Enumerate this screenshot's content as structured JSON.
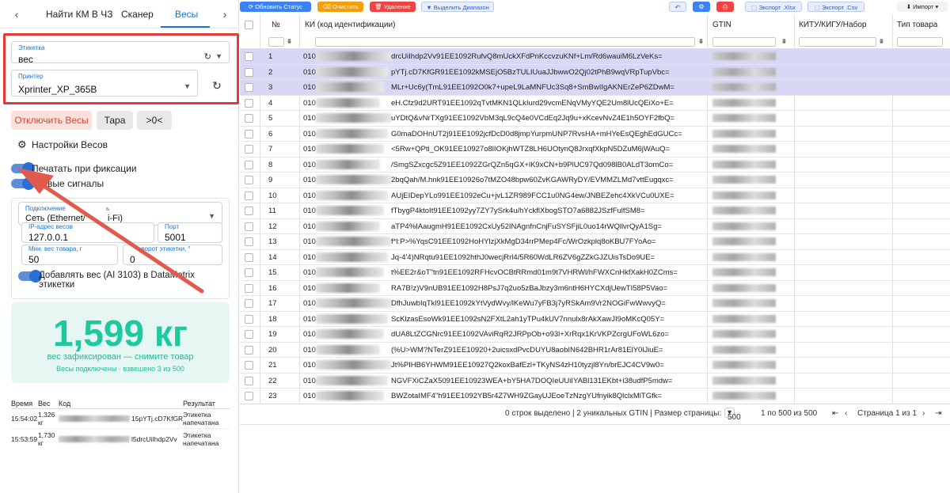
{
  "left": {
    "tabs": [
      "Найти КМ В ЧЗ",
      "Сканер",
      "Весы"
    ],
    "label_field": {
      "label": "Этикетка",
      "value": "вес"
    },
    "printer_field": {
      "label": "Принтер",
      "value": "Xprinter_XP_365B"
    },
    "buttons": {
      "disable_scales": "Отключить Весы",
      "tare": "Тара",
      "zero": ">0<"
    },
    "settings_title": "Настройки Весов",
    "toggles": {
      "print_on_fix": "Печатать при фиксации",
      "sound": "ковые сигналы"
    },
    "connection": {
      "label": "Подключение",
      "label_suffix": "ь",
      "value": "Сеть (Ethernet/",
      "value_suffix": "i-Fi)",
      "ip_label": "IP-адрес весов",
      "ip_value": "127.0.0.1",
      "port_label": "Порт",
      "port_value": "5001",
      "min_label": "Мин. вес товара, г",
      "min_value": "50",
      "rotate_label": "оворот этикетки, °",
      "rotate_value": "0",
      "add_weight": "Добавлять вес (AI 3103) в DataMatrix этикетки"
    },
    "weight": {
      "value": "1,599 кг",
      "status": "вес зафиксирован — снимите товар",
      "sub": "Весы подключены · взвешено 3 из 500"
    },
    "log": {
      "headers": [
        "Время",
        "Вес",
        "Код",
        "Результат"
      ],
      "rows": [
        {
          "time": "15:54:02",
          "weight": "1,326",
          "unit": "кг",
          "code_tail": "15pYTj.cD7KfGR",
          "result1": "Этикетка",
          "result2": "напечатана"
        },
        {
          "time": "15:53:59",
          "weight": "1,730",
          "unit": "кг",
          "code_tail": "l5drcUiIhdp2Vv",
          "result1": "Этикетка",
          "result2": "напечатана"
        }
      ]
    }
  },
  "toolbar": {
    "update_status": "Обновить Статус",
    "clear": "Очистить",
    "delete": "Удаление",
    "select_range": "Выделить Диапазон",
    "export_xlsx": "Экспорт .Xlsx",
    "export_csv": "Экспорт .Csv",
    "import": "Импорт"
  },
  "grid": {
    "headers": {
      "num": "№",
      "ki": "КИ (код идентификации)",
      "gtin": "GTIN",
      "kitu": "КИТУ/КИГУ/Набор",
      "type": "Тип товара"
    },
    "prefix": "010",
    "rows": [
      {
        "n": "1",
        "ki": "drcUiIhdp2Vv91EE1092RufvQ8mUckXFdPnKccvzuKNf+Lm/Rd6wauiM6LzVeKs=",
        "sel": true
      },
      {
        "n": "2",
        "ki": "pYTj.cD7KfGR91EE1092kMSEjO5BzTULIUuaJJbwwO2Qj02tPhB9wqVRpTupVbc=",
        "sel": true
      },
      {
        "n": "3",
        "ki": "MLr+Uc6y(TmL91EE1092O0k7+upeL9LaMNFUc3Sq8+SmBwIIgAKNErZeP6ZDwM=",
        "sel": true
      },
      {
        "n": "4",
        "ki": "eH.Cfz9d2URT91EE1092qTvtMKN1QLkIurd29vcmENqVMyYQE2Um8lUcQEiXo+E=",
        "sel": false
      },
      {
        "n": "5",
        "ki": "uYDtQ&vNrTXg91EE1092VbM3qL9cQ4e0VCdEq2Jq9u+xKcevNvZ4E1h5OYF2fbQ=",
        "sel": false
      },
      {
        "n": "6",
        "ki": "G0maDOHnUT2j91EE1092jcfDcD0d8jmpYurpmUNP7RvsHA+mHYeEsQEghEdGUCc=",
        "sel": false
      },
      {
        "n": "7",
        "ki": "<5Rw+QPti_OK91EE10927o8lIOKjhWTZ8LH6UOtynQ8JrxqfXkpN5DZuM6jWAuQ=",
        "sel": false
      },
      {
        "n": "8",
        "ki": "/SmgSZxcgc5Z91EE1092ZGrQZn5qGX+lK9xCN+b9PlUC97Qd098lB0ALdT3omCo=",
        "sel": false
      },
      {
        "n": "9",
        "ki": "2bqQah/M.hnk91EE10926o7tMZO48bpw60ZvKGAWRyDY/EVMMZLMd7vttEugqxc=",
        "sel": false
      },
      {
        "n": "10",
        "ki": "AUjEIDepYLo991EE1092eCu+jvL1ZR989FCC1u0NG4ew/JNBEZehc4XkVCu0UXE=",
        "sel": false
      },
      {
        "n": "11",
        "ki": "fTbygP4ktoIt91EE1092yy7ZY7ySrk4u/hYckflXbogSTO7a6882JSzfFulfSM8=",
        "sel": false
      },
      {
        "n": "12",
        "ki": "aTP4%IAaugmH91EE1092CxUy52INAgnfnCnjFuSYSFjiL0uo14rWQllvrQyA1Sg=",
        "sel": false
      },
      {
        "n": "13",
        "ki": "f*l:P>%YqsC91EE1092HoHYlzjXkMgD34rrPMep4Fc/WrOzkplq8oKBU7FYoAo=",
        "sel": false
      },
      {
        "n": "14",
        "ki": "Jq-4'4)NRqtu91EE1092hthJ0wecjRrl4/5R60WdLR6ZV6gZZkGJZUisTsDo9UE=",
        "sel": false
      },
      {
        "n": "15",
        "ki": "t%EE2r&oT\"tn91EE1092RFHcvOCBtRRmd01m9t7VHRWl/hFWXCnHkfXakH0ZCms=",
        "sel": false
      },
      {
        "n": "16",
        "ki": "RA7B!z)V9nUB91EE1092H8PsJ7q2uo5zBaJbzy3m6ntH6HYCXdjUewTI58P5Vao=",
        "sel": false
      },
      {
        "n": "17",
        "ki": "DfhJuwbIqTkl91EE1092kYtVydWvy/lKeWu7yFB3j7yRSkAm9Vr2NOGiFwWwvyQ=",
        "sel": false
      },
      {
        "n": "18",
        "ki": "ScKlzasEsoWk91EE1092sN2FXtL2ah1yTPu4kUV7nnulx8rAkXawJI9oMKcQ05Y=",
        "sel": false
      },
      {
        "n": "19",
        "ki": "dUA8LtZCGNrc91EE1092VAviRqR2JRPpOb+o93l+XrRqx1KrVKPZcrgUFoWL6zo=",
        "sel": false
      },
      {
        "n": "20",
        "ki": "(%U>WM?NTerZ91EE10920+2uicsxdPvcDUYU8aobIN642BHR1rAr81ElY0lJiuE=",
        "sel": false
      },
      {
        "n": "21",
        "ki": "Jt%PIHB6YHWM91EE10927Q2koxBafEzl+TKyNS4zH10tyzjl8Yn/brEJC4CV9w0=",
        "sel": false
      },
      {
        "n": "22",
        "ki": "NGVFXiCZaX5091EE10923WEA+bY5HA7DOQIeUUiIYABl131EKbt+i38udfP5mdw=",
        "sel": false
      },
      {
        "n": "23",
        "ki": "BWZotaIMF4\"h91EE1092YB5r4Z7WH9ZGayUJEoeTzNzgYUfnyik8QlclxMlTGfk=",
        "sel": false
      }
    ],
    "footer": {
      "selected": "0 строк выделено | 2 уникальных GTIN | Размер страницы:",
      "page_size": "500",
      "range": "1 по 500 из 500",
      "page": "Страница 1 из 1"
    }
  },
  "colors": {
    "accent": "#1976d2",
    "highlight": "#e53935",
    "weight": "#1ec9a0",
    "selected_row": "#d8d8f6"
  }
}
